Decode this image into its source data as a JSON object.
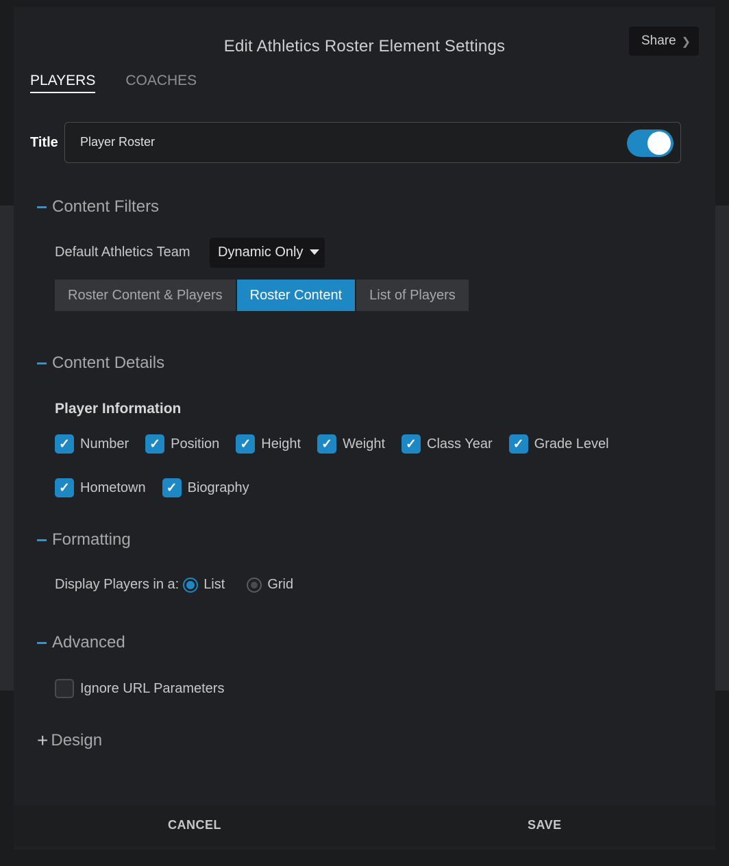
{
  "modal": {
    "title": "Edit Athletics Roster Element Settings",
    "share_label": "Share",
    "chevron_icon": "chevron-right-icon"
  },
  "tabs": [
    {
      "label": "PLAYERS",
      "active": true
    },
    {
      "label": "COACHES",
      "active": false
    }
  ],
  "title_field": {
    "label": "Title",
    "value": "Player Roster",
    "toggle_on": true
  },
  "sections": {
    "content_filters": {
      "heading": "Content Filters",
      "team_label": "Default Athletics Team",
      "team_value": "Dynamic Only",
      "segments": [
        {
          "label": "Roster Content & Players",
          "active": false
        },
        {
          "label": "Roster Content",
          "active": true
        },
        {
          "label": "List of Players",
          "active": false
        }
      ]
    },
    "content_details": {
      "heading": "Content Details",
      "subheading": "Player Information",
      "checkboxes_row1": [
        {
          "label": "Number",
          "checked": true
        },
        {
          "label": "Position",
          "checked": true
        },
        {
          "label": "Height",
          "checked": true
        },
        {
          "label": "Weight",
          "checked": true
        },
        {
          "label": "Class Year",
          "checked": true
        },
        {
          "label": "Grade Level",
          "checked": true
        }
      ],
      "checkboxes_row2": [
        {
          "label": "Hometown",
          "checked": true
        },
        {
          "label": "Biography",
          "checked": true
        }
      ]
    },
    "formatting": {
      "heading": "Formatting",
      "display_label": "Display Players in a:",
      "options": [
        {
          "label": "List",
          "selected": true
        },
        {
          "label": "Grid",
          "selected": false
        }
      ]
    },
    "advanced": {
      "heading": "Advanced",
      "ignore_url_label": "Ignore URL Parameters",
      "ignore_url_checked": false
    },
    "design": {
      "heading": "Design"
    }
  },
  "footer": {
    "cancel_label": "CANCEL",
    "save_label": "SAVE"
  },
  "colors": {
    "accent": "#1e88c4",
    "background": "#202124"
  }
}
